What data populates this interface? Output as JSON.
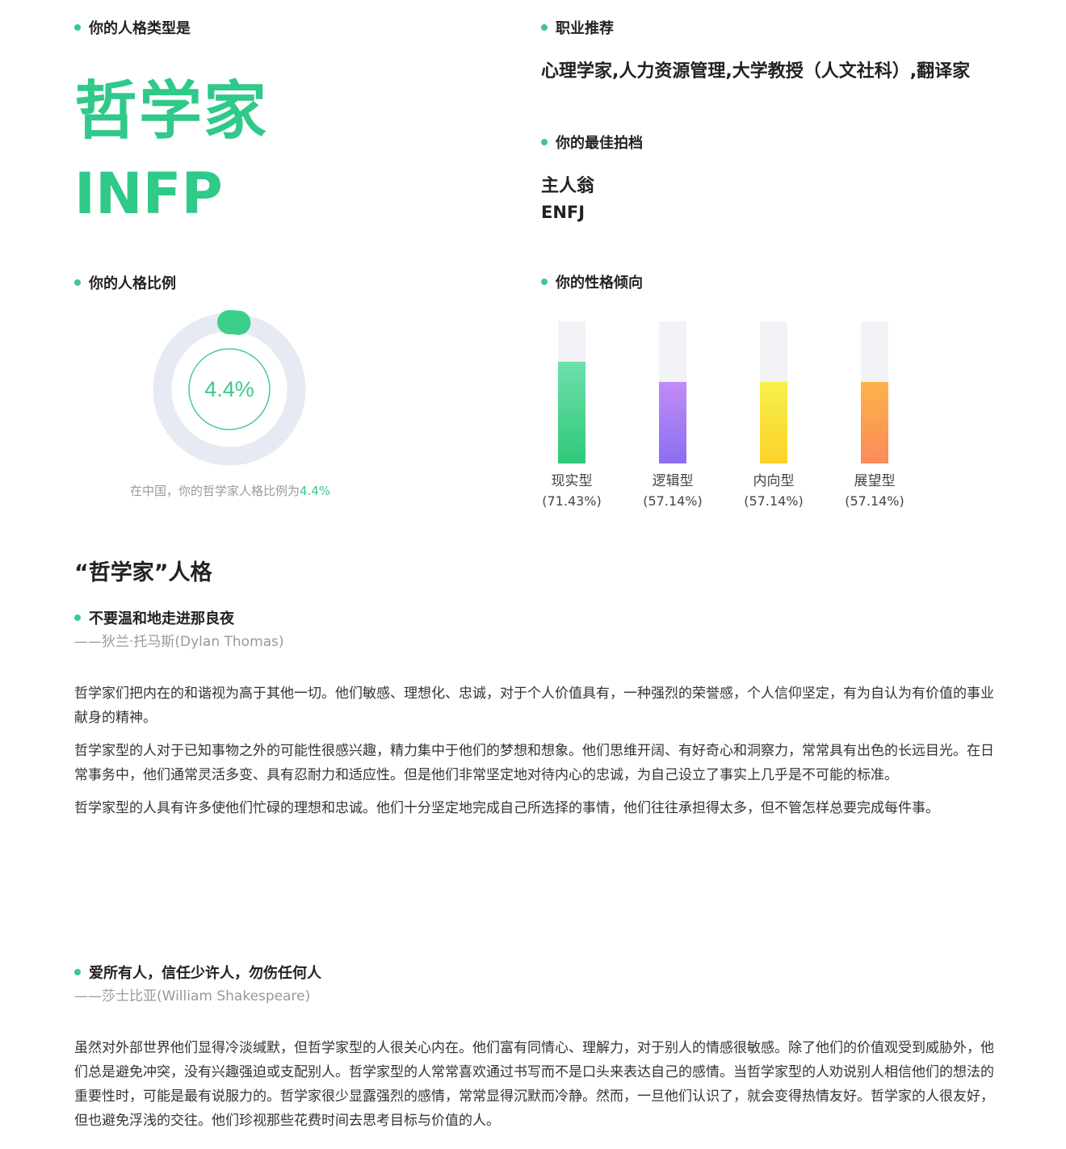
{
  "type_section": {
    "label": "你的人格类型是",
    "name_cn": "哲学家",
    "code": "INFP"
  },
  "career_section": {
    "label": "职业推荐",
    "text": "心理学家,人力资源管理,大学教授（人文社科）,翻译家"
  },
  "partner_section": {
    "label": "你的最佳拍档",
    "name": "主人翁",
    "code": "ENFJ"
  },
  "ratio_section": {
    "label": "你的人格比例",
    "value_label": "4.4%",
    "value": 4.4,
    "caption_prefix": "在中国，你的哲学家人格比例为",
    "caption_value": "4.4%"
  },
  "tendency_section": {
    "label": "你的性格倾向",
    "bars": [
      {
        "name": "现实型",
        "pct_label": "(71.43%)",
        "value": 71.43,
        "color_top": "#6fe0ab",
        "color_bottom": "#2fc87a"
      },
      {
        "name": "逻辑型",
        "pct_label": "(57.14%)",
        "value": 57.14,
        "color_top": "#c28cf5",
        "color_bottom": "#8a6ef0"
      },
      {
        "name": "内向型",
        "pct_label": "(57.14%)",
        "value": 57.14,
        "color_top": "#f7ef4a",
        "color_bottom": "#fcd22a"
      },
      {
        "name": "展望型",
        "pct_label": "(57.14%)",
        "value": 57.14,
        "color_top": "#fcb44a",
        "color_bottom": "#fb8a5a"
      }
    ]
  },
  "persona": {
    "heading": "“哲学家”人格",
    "quote1": {
      "text": "不要温和地走进那良夜",
      "author": "——狄兰·托马斯(Dylan Thomas)"
    },
    "paragraphs1": [
      "哲学家们把内在的和谐视为高于其他一切。他们敏感、理想化、忠诚，对于个人价值具有，一种强烈的荣誉感，个人信仰坚定，有为自认为有价值的事业献身的精神。",
      "哲学家型的人对于已知事物之外的可能性很感兴趣，精力集中于他们的梦想和想象。他们思维开阔、有好奇心和洞察力，常常具有出色的长远目光。在日常事务中，他们通常灵活多变、具有忍耐力和适应性。但是他们非常坚定地对待内心的忠诚，为自己设立了事实上几乎是不可能的标准。",
      "哲学家型的人具有许多使他们忙碌的理想和忠诚。他们十分坚定地完成自己所选择的事情，他们往往承担得太多，但不管怎样总要完成每件事。"
    ],
    "quote2": {
      "text": "爱所有人，信任少许人，勿伤任何人",
      "author": "——莎士比亚(William Shakespeare)"
    },
    "paragraphs2": [
      "虽然对外部世界他们显得冷淡缄默，但哲学家型的人很关心内在。他们富有同情心、理解力，对于别人的情感很敏感。除了他们的价值观受到威胁外，他们总是避免冲突，没有兴趣强迫或支配别人。哲学家型的人常常喜欢通过书写而不是口头来表达自己的感情。当哲学家型的人劝说别人相信他们的想法的重要性时，可能是最有说服力的。哲学家很少显露强烈的感情，常常显得沉默而冷静。然而，一旦他们认识了，就会变得热情友好。哲学家的人很友好，但也避免浮浅的交往。他们珍视那些花费时间去思考目标与价值的人。"
    ]
  },
  "colors": {
    "accent": "#2fc98a",
    "ring_track": "#e6eaf2",
    "muted_text": "#999999"
  }
}
